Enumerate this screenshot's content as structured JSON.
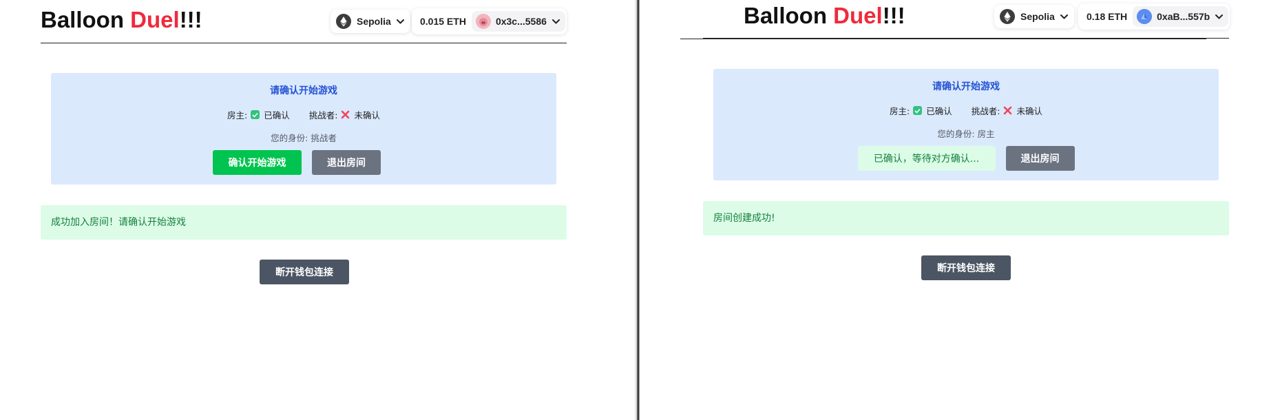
{
  "left": {
    "header": {
      "title_part1": "Balloon ",
      "title_part2": "Duel",
      "title_part3": "!!!",
      "network": "Sepolia",
      "balance": "0.015 ETH",
      "address": "0x3c...5586"
    },
    "card": {
      "title": "请确认开始游戏",
      "host_label": "房主:",
      "host_status": "已确认",
      "challenger_label": "挑战者:",
      "challenger_status": "未确认",
      "identity": "您的身份: 挑战者",
      "confirm_button": "确认开始游戏",
      "leave_button": "退出房间"
    },
    "message": "成功加入房间！请确认开始游戏",
    "disconnect_button": "断开钱包连接"
  },
  "right": {
    "header": {
      "title_part1": "Balloon ",
      "title_part2": "Duel",
      "title_part3": "!!!",
      "network": "Sepolia",
      "balance": "0.18 ETH",
      "address": "0xaB...557b"
    },
    "card": {
      "title": "请确认开始游戏",
      "host_label": "房主:",
      "host_status": "已确认",
      "challenger_label": "挑战者:",
      "challenger_status": "未确认",
      "identity": "您的身份: 房主",
      "waiting_text": "已确认，等待对方确认...",
      "leave_button": "退出房间"
    },
    "message": "房间创建成功!",
    "disconnect_button": "断开钱包连接"
  },
  "colors": {
    "accent_red": "#ee2b3b",
    "card_bg": "#dbe9fd",
    "card_title": "#2453d4",
    "success_bg": "#dcfce7",
    "success_text": "#15803d",
    "confirm_green": "#00c44f",
    "leave_gray": "#6b7280",
    "disconnect_gray": "#4b5563"
  }
}
